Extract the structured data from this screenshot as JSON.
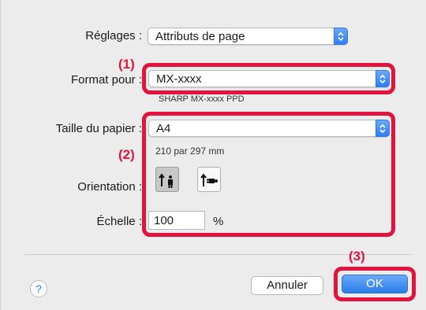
{
  "settings": {
    "label": "Réglages :",
    "value": "Attributs de page"
  },
  "format": {
    "label": "Format pour :",
    "value": "MX-xxxx",
    "subtitle": "SHARP MX-xxxx PPD"
  },
  "paper": {
    "label": "Taille du papier :",
    "value": "A4",
    "dimensions": "210 par 297 mm"
  },
  "orientation": {
    "label": "Orientation :",
    "options": [
      "portrait",
      "landscape"
    ],
    "selected": "portrait"
  },
  "scale": {
    "label": "Échelle :",
    "value": "100",
    "unit": "%"
  },
  "buttons": {
    "help": "?",
    "cancel": "Annuler",
    "ok": "OK"
  },
  "callouts": {
    "c1": "(1)",
    "c2": "(2)",
    "c3": "(3)"
  },
  "colors": {
    "highlight": "#e3133e",
    "accent": "#2c7ff0"
  }
}
